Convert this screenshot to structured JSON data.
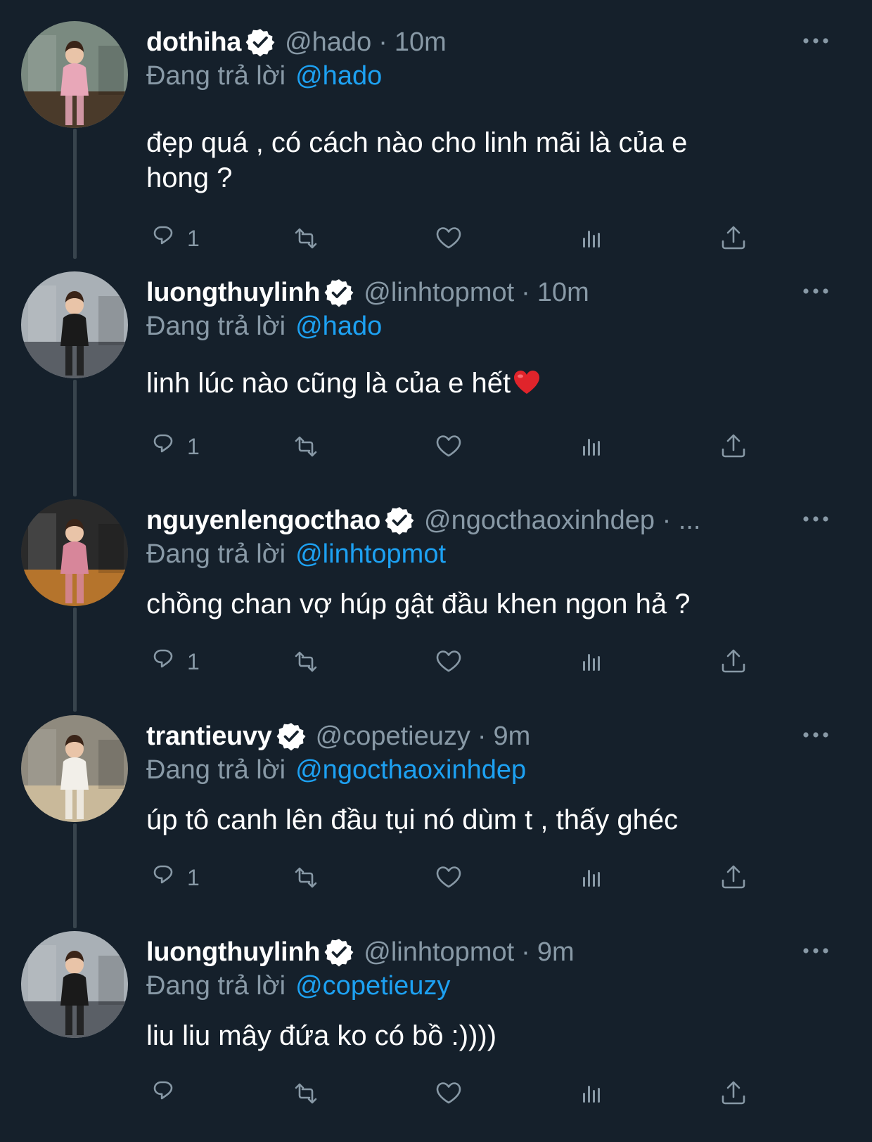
{
  "reply_prefix": "Đang trả lời",
  "tweets": [
    {
      "display_name": "dothiha",
      "handle": "@hado",
      "time": "10m",
      "reply_to": "@hado",
      "text_lines": [
        "đẹp quá , có cách nào cho linh mãi là của e",
        "hong ?"
      ],
      "text_suffix_emoji": null,
      "reply_count": "1",
      "avatar_palette": {
        "bg": "#7a8a80",
        "accent": "#e8a7b8",
        "ground": "#4a3a2a"
      }
    },
    {
      "display_name": "luongthuylinh",
      "handle": "@linhtopmot",
      "time": "10m",
      "reply_to": "@hado",
      "text_lines": [
        "linh lúc nào cũng là của e hết"
      ],
      "text_suffix_emoji": "red-heart",
      "reply_count": "1",
      "avatar_palette": {
        "bg": "#a9b0b6",
        "accent": "#1a1a1a",
        "ground": "#5a5f66"
      }
    },
    {
      "display_name": "nguyenlengocthao",
      "handle": "@ngocthaoxinhdep · ...",
      "time": "",
      "reply_to": "@linhtopmot",
      "text_lines": [
        "chồng chan vợ húp gật đầu khen ngon hả ?"
      ],
      "text_suffix_emoji": null,
      "reply_count": "1",
      "avatar_palette": {
        "bg": "#2a2a2a",
        "accent": "#d7869a",
        "ground": "#b5742c"
      }
    },
    {
      "display_name": "trantieuvy",
      "handle": "@copetieuzy",
      "time": "9m",
      "reply_to": "@ngocthaoxinhdep",
      "text_lines": [
        "úp tô canh lên đầu tụi nó dùm t , thấy ghéc"
      ],
      "text_suffix_emoji": null,
      "reply_count": "1",
      "avatar_palette": {
        "bg": "#8f8a7e",
        "accent": "#f2efe9",
        "ground": "#c9b99a"
      }
    },
    {
      "display_name": "luongthuylinh",
      "handle": "@linhtopmot",
      "time": "9m",
      "reply_to": "@copetieuzy",
      "text_lines": [
        "liu liu mây đứa ko có bồ :))))"
      ],
      "text_suffix_emoji": null,
      "reply_count": "",
      "avatar_palette": {
        "bg": "#a9b0b6",
        "accent": "#1a1a1a",
        "ground": "#5a5f66"
      }
    }
  ],
  "colors": {
    "background": "#15202b",
    "muted": "#8899a6",
    "link": "#1da1f2",
    "thread_line": "#38444d",
    "text": "#ffffff"
  },
  "icons": {
    "verified": "verified-badge-icon",
    "more": "more-horizontal-icon",
    "reply": "reply-bubble-icon",
    "retweet": "retweet-icon",
    "like": "heart-outline-icon",
    "views": "analytics-bars-icon",
    "share": "share-upload-icon"
  }
}
